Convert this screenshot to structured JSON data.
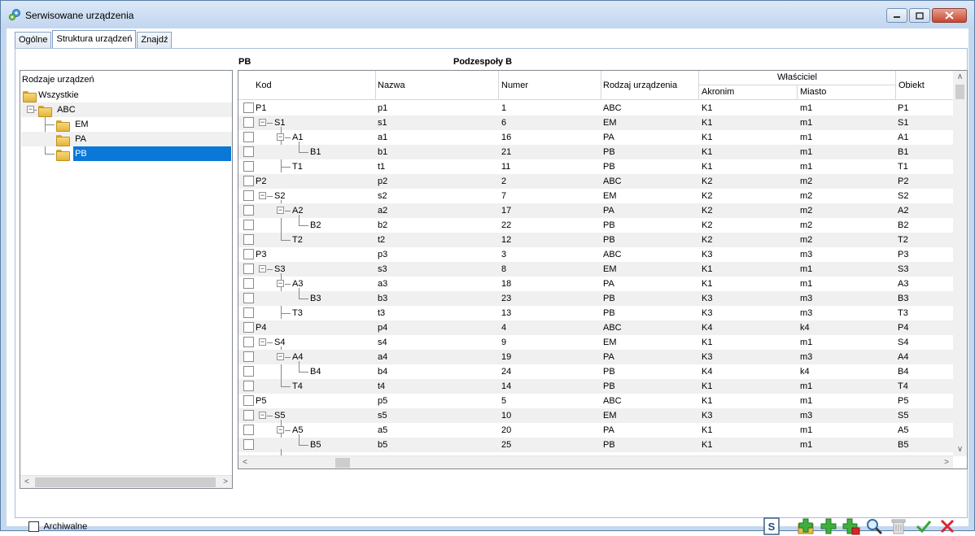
{
  "window": {
    "title": "Serwisowane urządzenia"
  },
  "tabs": [
    "Ogólne",
    "Struktura urządzeń",
    "Znajdź"
  ],
  "labels": {
    "selected_type": "PB",
    "grid_title": "Podzespoły B"
  },
  "tree": {
    "header": "Rodzaje urządzeń",
    "root": "Wszystkie",
    "abc": "ABC",
    "children": [
      "EM",
      "PA",
      "PB"
    ],
    "selected": "PB"
  },
  "grid": {
    "columns": {
      "kod": "Kod",
      "nazwa": "Nazwa",
      "numer": "Numer",
      "rodzaj": "Rodzaj urządzenia",
      "wlasciciel": "Właściciel",
      "akronim": "Akronim",
      "miasto": "Miasto",
      "obiekt": "Obiekt"
    },
    "rows": [
      {
        "level": 0,
        "kod": "P1",
        "nazwa": "p1",
        "numer": "1",
        "rodzaj": "ABC",
        "akronim": "K1",
        "miasto": "m1",
        "obiekt": "P1"
      },
      {
        "level": 1,
        "kod": "S1",
        "nazwa": "s1",
        "numer": "6",
        "rodzaj": "EM",
        "akronim": "K1",
        "miasto": "m1",
        "obiekt": "S1"
      },
      {
        "level": 2,
        "kod": "A1",
        "nazwa": "a1",
        "numer": "16",
        "rodzaj": "PA",
        "akronim": "K1",
        "miasto": "m1",
        "obiekt": "A1"
      },
      {
        "level": 3,
        "kod": "B1",
        "nazwa": "b1",
        "numer": "21",
        "rodzaj": "PB",
        "akronim": "K1",
        "miasto": "m1",
        "obiekt": "B1"
      },
      {
        "level": 4,
        "kod": "T1",
        "nazwa": "t1",
        "numer": "11",
        "rodzaj": "PB",
        "akronim": "K1",
        "miasto": "m1",
        "obiekt": "T1"
      },
      {
        "level": 0,
        "kod": "P2",
        "nazwa": "p2",
        "numer": "2",
        "rodzaj": "ABC",
        "akronim": "K2",
        "miasto": "m2",
        "obiekt": "P2"
      },
      {
        "level": 1,
        "kod": "S2",
        "nazwa": "s2",
        "numer": "7",
        "rodzaj": "EM",
        "akronim": "K2",
        "miasto": "m2",
        "obiekt": "S2"
      },
      {
        "level": 2,
        "kod": "A2",
        "nazwa": "a2",
        "numer": "17",
        "rodzaj": "PA",
        "akronim": "K2",
        "miasto": "m2",
        "obiekt": "A2"
      },
      {
        "level": 3,
        "kod": "B2",
        "nazwa": "b2",
        "numer": "22",
        "rodzaj": "PB",
        "akronim": "K2",
        "miasto": "m2",
        "obiekt": "B2"
      },
      {
        "level": 4,
        "kod": "T2",
        "nazwa": "t2",
        "numer": "12",
        "rodzaj": "PB",
        "akronim": "K2",
        "miasto": "m2",
        "obiekt": "T2"
      },
      {
        "level": 0,
        "kod": "P3",
        "nazwa": "p3",
        "numer": "3",
        "rodzaj": "ABC",
        "akronim": "K3",
        "miasto": "m3",
        "obiekt": "P3"
      },
      {
        "level": 1,
        "kod": "S3",
        "nazwa": "s3",
        "numer": "8",
        "rodzaj": "EM",
        "akronim": "K1",
        "miasto": "m1",
        "obiekt": "S3"
      },
      {
        "level": 2,
        "kod": "A3",
        "nazwa": "a3",
        "numer": "18",
        "rodzaj": "PA",
        "akronim": "K1",
        "miasto": "m1",
        "obiekt": "A3"
      },
      {
        "level": 3,
        "kod": "B3",
        "nazwa": "b3",
        "numer": "23",
        "rodzaj": "PB",
        "akronim": "K3",
        "miasto": "m3",
        "obiekt": "B3"
      },
      {
        "level": 4,
        "kod": "T3",
        "nazwa": "t3",
        "numer": "13",
        "rodzaj": "PB",
        "akronim": "K3",
        "miasto": "m3",
        "obiekt": "T3"
      },
      {
        "level": 0,
        "kod": "P4",
        "nazwa": "p4",
        "numer": "4",
        "rodzaj": "ABC",
        "akronim": "K4",
        "miasto": "k4",
        "obiekt": "P4"
      },
      {
        "level": 1,
        "kod": "S4",
        "nazwa": "s4",
        "numer": "9",
        "rodzaj": "EM",
        "akronim": "K1",
        "miasto": "m1",
        "obiekt": "S4"
      },
      {
        "level": 2,
        "kod": "A4",
        "nazwa": "a4",
        "numer": "19",
        "rodzaj": "PA",
        "akronim": "K3",
        "miasto": "m3",
        "obiekt": "A4"
      },
      {
        "level": 3,
        "kod": "B4",
        "nazwa": "b4",
        "numer": "24",
        "rodzaj": "PB",
        "akronim": "K4",
        "miasto": "k4",
        "obiekt": "B4"
      },
      {
        "level": 4,
        "kod": "T4",
        "nazwa": "t4",
        "numer": "14",
        "rodzaj": "PB",
        "akronim": "K1",
        "miasto": "m1",
        "obiekt": "T4"
      },
      {
        "level": 0,
        "kod": "P5",
        "nazwa": "p5",
        "numer": "5",
        "rodzaj": "ABC",
        "akronim": "K1",
        "miasto": "m1",
        "obiekt": "P5"
      },
      {
        "level": 1,
        "kod": "S5",
        "nazwa": "s5",
        "numer": "10",
        "rodzaj": "EM",
        "akronim": "K3",
        "miasto": "m3",
        "obiekt": "S5"
      },
      {
        "level": 2,
        "kod": "A5",
        "nazwa": "a5",
        "numer": "20",
        "rodzaj": "PA",
        "akronim": "K1",
        "miasto": "m1",
        "obiekt": "A5"
      },
      {
        "level": 3,
        "kod": "B5",
        "nazwa": "b5",
        "numer": "25",
        "rodzaj": "PB",
        "akronim": "K1",
        "miasto": "m1",
        "obiekt": "B5"
      }
    ]
  },
  "footer": {
    "archive_label": "Archiwalne",
    "archive_checked": false
  },
  "toolbar": {
    "icons": [
      "script-icon",
      "add-folder-icon",
      "add-icon",
      "add-subitem-icon",
      "search-icon",
      "trash-icon",
      "confirm-icon",
      "cancel-icon"
    ]
  },
  "colors": {
    "selection": "#0a78d7",
    "confirm": "#3aa33a",
    "cancel": "#d7262b",
    "add": "#2f9e2f"
  }
}
